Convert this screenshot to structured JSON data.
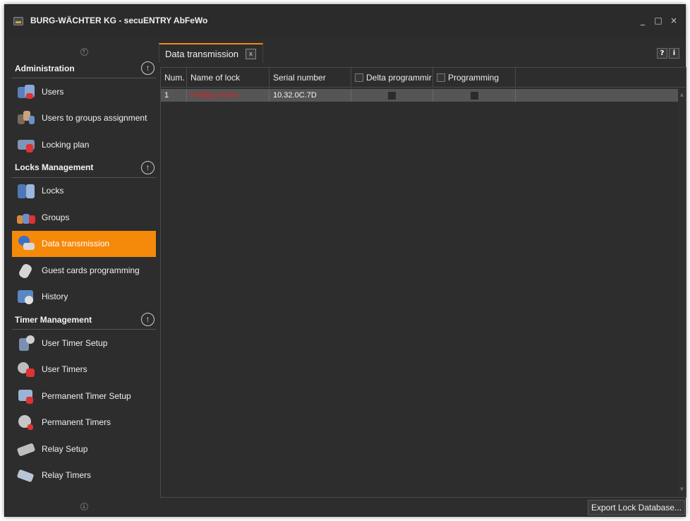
{
  "window": {
    "title": "BURG-WÄCHTER KG - secuENTRY AbFeWo",
    "controls": [
      "_",
      "□",
      "×"
    ]
  },
  "sidebar": {
    "scroll_up": "↑",
    "scroll_down": "↓",
    "sections": [
      {
        "title": "Administration",
        "collapse_icon": "↑",
        "items": [
          {
            "label": "Users",
            "icon": "users-icon",
            "active": false
          },
          {
            "label": "Users to groups assignment",
            "icon": "users-groups-assignment-icon",
            "active": false
          },
          {
            "label": "Locking plan",
            "icon": "locking-plan-icon",
            "active": false
          }
        ]
      },
      {
        "title": "Locks Management",
        "collapse_icon": "↑",
        "items": [
          {
            "label": "Locks",
            "icon": "locks-icon",
            "active": false
          },
          {
            "label": "Groups",
            "icon": "groups-icon",
            "active": false
          },
          {
            "label": "Data transmission",
            "icon": "data-transmission-icon",
            "active": true
          },
          {
            "label": "Guest cards programming",
            "icon": "guest-card-icon",
            "active": false
          },
          {
            "label": "History",
            "icon": "history-icon",
            "active": false
          }
        ]
      },
      {
        "title": "Timer Management",
        "collapse_icon": "↑",
        "items": [
          {
            "label": "User Timer Setup",
            "icon": "user-timer-setup-icon",
            "active": false
          },
          {
            "label": "User Timers",
            "icon": "user-timers-icon",
            "active": false
          },
          {
            "label": "Permanent Timer Setup",
            "icon": "permanent-timer-setup-icon",
            "active": false
          },
          {
            "label": "Permanent Timers",
            "icon": "permanent-timers-icon",
            "active": false
          },
          {
            "label": "Relay Setup",
            "icon": "relay-setup-icon",
            "active": false
          },
          {
            "label": "Relay Timers",
            "icon": "relay-timers-icon",
            "active": false
          }
        ]
      }
    ]
  },
  "tab": {
    "label": "Data transmission",
    "close": "x"
  },
  "help_buttons": [
    "?",
    "i"
  ],
  "grid": {
    "columns": [
      "Num.",
      "Name of lock",
      "Serial number",
      "Delta programmir",
      "Programming"
    ],
    "rows": [
      {
        "num": "1",
        "name": "Holiday home",
        "serial": "10.32.0C.7D",
        "delta": false,
        "programming": false
      }
    ]
  },
  "export_button": "Export Lock Database...",
  "colors": {
    "accent": "#f5890a",
    "background": "#2d2d2d",
    "selected_row": "#555555",
    "lock_name": "#e02020"
  }
}
